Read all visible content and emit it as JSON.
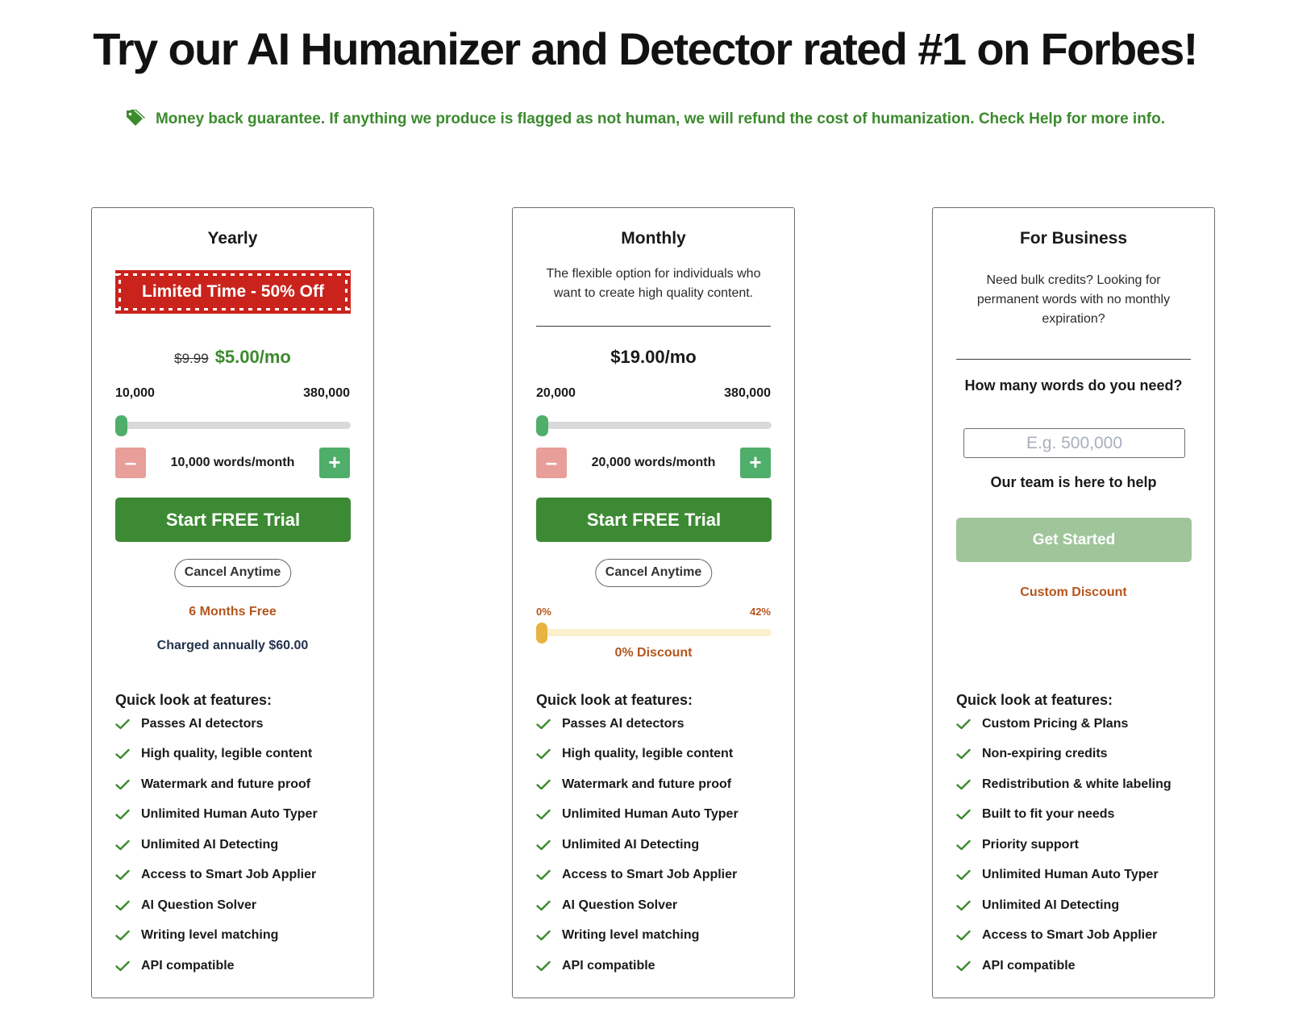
{
  "header": {
    "headline": "Try our AI Humanizer and Detector rated #1 on Forbes!",
    "guarantee": "Money back guarantee. If anything we produce is flagged as not human, we will refund the cost of humanization. Check Help for more info."
  },
  "colors": {
    "accent_green": "#3d8a34",
    "promo_red": "#c9231c",
    "discount_orange": "#b4561d",
    "slider_green": "#4fae6a",
    "slider_yellow": "#e8b340"
  },
  "yearly": {
    "title": "Yearly",
    "promo": "Limited Time - 50% Off",
    "old_price": "$9.99",
    "price": "$5.00/mo",
    "range_min": "10,000",
    "range_max": "380,000",
    "slider_value": 10000,
    "minus_label": "–",
    "plus_label": "+",
    "words": "10,000 words/month",
    "cta": "Start FREE Trial",
    "cancel": "Cancel Anytime",
    "months_free": "6 Months Free",
    "charged": "Charged annually $60.00",
    "features_title": "Quick look at features:",
    "features": [
      "Passes AI detectors",
      "High quality, legible content",
      "Watermark and future proof",
      "Unlimited Human Auto Typer",
      "Unlimited AI Detecting",
      "Access to Smart Job Applier",
      "AI Question Solver",
      "Writing level matching",
      "API compatible"
    ]
  },
  "monthly": {
    "title": "Monthly",
    "description": "The flexible option for individuals who want to create high quality content.",
    "price": "$19.00/mo",
    "range_min": "20,000",
    "range_max": "380,000",
    "slider_value": 20000,
    "minus_label": "–",
    "plus_label": "+",
    "words": "20,000 words/month",
    "cta": "Start FREE Trial",
    "cancel": "Cancel Anytime",
    "discount_min": "0%",
    "discount_max": "42%",
    "discount_value": 0,
    "discount_label": "0% Discount",
    "features_title": "Quick look at features:",
    "features": [
      "Passes AI detectors",
      "High quality, legible content",
      "Watermark and future proof",
      "Unlimited Human Auto Typer",
      "Unlimited AI Detecting",
      "Access to Smart Job Applier",
      "AI Question Solver",
      "Writing level matching",
      "API compatible"
    ]
  },
  "business": {
    "title": "For Business",
    "description": "Need bulk credits? Looking for permanent words with no monthly expiration?",
    "question": "How many words do you need?",
    "input_placeholder": "E.g. 500,000",
    "input_value": "",
    "help": "Our team is here to help",
    "cta": "Get Started",
    "custom_discount": "Custom Discount",
    "features_title": "Quick look at features:",
    "features": [
      "Custom Pricing & Plans",
      "Non-expiring credits",
      "Redistribution & white labeling",
      "Built to fit your needs",
      "Priority support",
      "Unlimited Human Auto Typer",
      "Unlimited AI Detecting",
      "Access to Smart Job Applier",
      "API compatible"
    ]
  }
}
